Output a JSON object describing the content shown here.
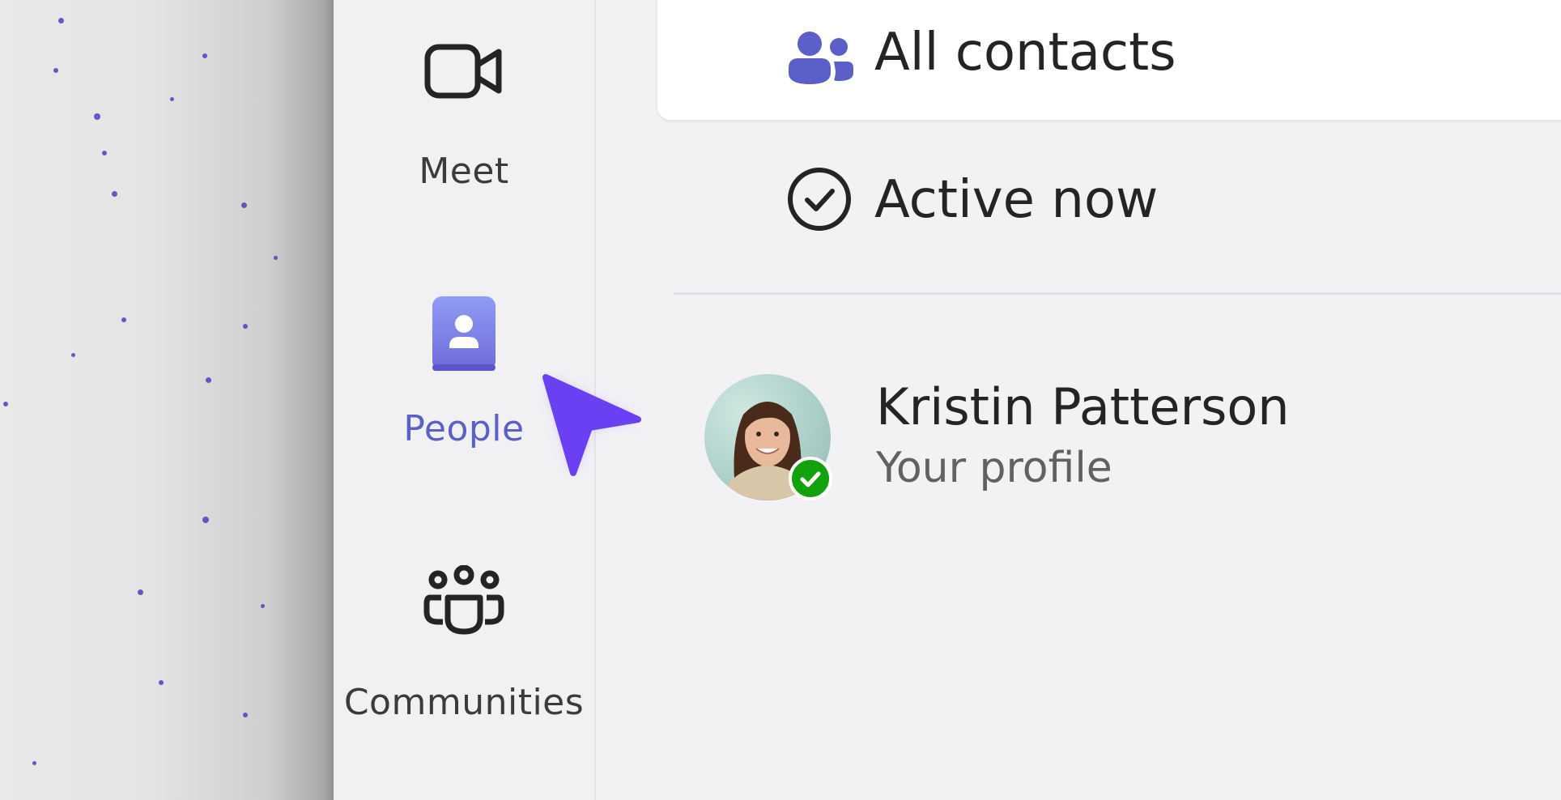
{
  "rail": {
    "items": [
      {
        "label": "Meet",
        "icon": "video-camera-icon",
        "active": false
      },
      {
        "label": "People",
        "icon": "people-book-icon",
        "active": true
      },
      {
        "label": "Communities",
        "icon": "communities-icon",
        "active": false
      }
    ]
  },
  "main": {
    "filters": [
      {
        "label": "All contacts",
        "icon": "people-group-icon",
        "selected": true
      },
      {
        "label": "Active now",
        "icon": "check-circle-icon",
        "selected": false
      }
    ],
    "profile": {
      "name": "Kristin Patterson",
      "subtitle": "Your profile",
      "status": "available",
      "status_icon": "checkmark-icon"
    }
  },
  "colors": {
    "accent": "#5b5fc7",
    "available": "#13a10e",
    "cursor": "#6b3ff2"
  },
  "pointer": {
    "icon": "mouse-pointer-icon"
  }
}
